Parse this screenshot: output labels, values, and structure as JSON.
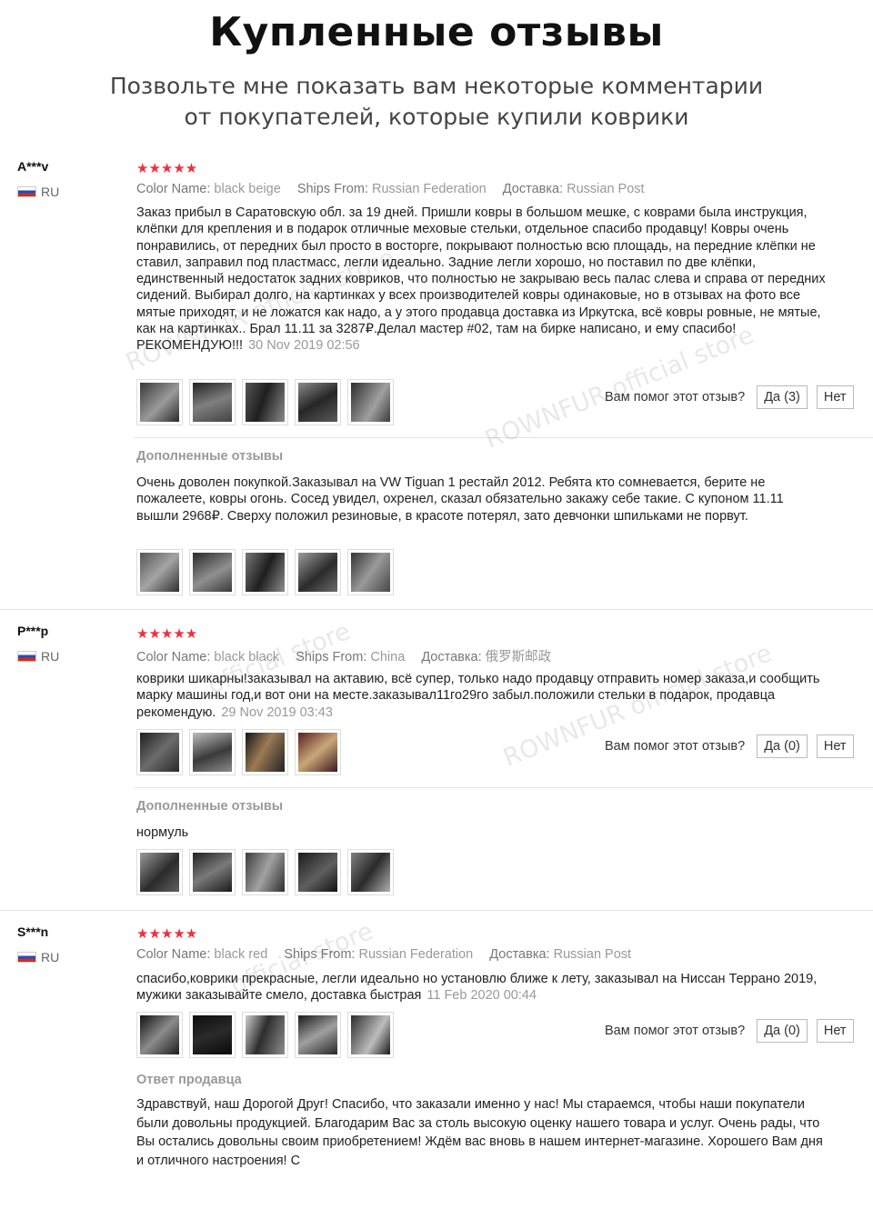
{
  "header": {
    "title": "Купленные отзывы",
    "subtitle_line1": "Позвольте мне показать вам некоторые комментарии",
    "subtitle_line2": "от покупателей, которые купили коврики"
  },
  "labels": {
    "color_name": "Color Name:",
    "ships_from": "Ships From:",
    "delivery": "Доставка:",
    "helpful_question": "Вам помог этот отзыв?",
    "no": "Нет",
    "additional_reviews": "Дополненные отзывы",
    "seller_reply": "Ответ продавца"
  },
  "watermarks": {
    "full": "ROWNFUR official store",
    "store": "official store"
  },
  "colors": {
    "star": "#ee2f3f",
    "text": "#222222",
    "meta": "#999999"
  },
  "reviews": [
    {
      "user": "A***v",
      "country": "RU",
      "rating": 5,
      "stars": "★★★★★",
      "color_name": "black beige",
      "ships_from": "Russian Federation",
      "delivery": "Russian Post",
      "text": "Заказ прибыл в Саратовскую обл. за 19 дней. Пришли ковры в большом мешке, с коврами была инструкция, клёпки для крепления и в подарок отличные меховые стельки, отдельное спасибо продавцу! Ковры очень понравились, от передних был просто в восторге, покрывают полностью всю площадь, на передние клёпки не ставил, заправил под пластмасс, легли идеально. Задние легли хорошо, но поставил по две клёпки, единственный недостаток задних ковриков, что полностью не закрываю весь палас слева и справа от передних сидений. Выбирал долго, на картинках у всех производителей ковры одинаковые, но в отзывах на фото все мятые приходят, и не ложатся как надо, а у этого продавца доставка из Иркутска, всё ковры ровные, не мятые, как на картинках.. Брал 11.11 за 3287₽.Делал мастер #02, там на бирке написано, и ему спасибо! РЕКОМЕНДУЮ!!!",
      "date": "30 Nov 2019 02:56",
      "yes": "Да (3)",
      "additional_text": "Очень доволен покупкой.Заказывал на VW Tiguan 1 рестайл 2012. Ребята кто сомневается, берите не пожалеете, ковры огонь. Сосед увидел, охренел, сказал обязательно закажу себе такие. С купоном 11.11 вышли 2968₽. Сверху положил резиновые, в красоте потерял, зато девчонки шпильками не порвут."
    },
    {
      "user": "P***p",
      "country": "RU",
      "rating": 5,
      "stars": "★★★★★",
      "color_name": "black black",
      "ships_from": "China",
      "delivery": "俄罗斯邮政",
      "text": "коврики шикарны!заказывал на актавию, всё супер, только надо продавцу отправить номер заказа,и сообщить марку машины год,и вот они на месте.заказывал11го29го забыл.положили стельки в подарок, продавца рекомендую.",
      "date": "29 Nov 2019 03:43",
      "yes": "Да (0)",
      "additional_text": "нормуль"
    },
    {
      "user": "S***n",
      "country": "RU",
      "rating": 5,
      "stars": "★★★★★",
      "color_name": "black red",
      "ships_from": "Russian Federation",
      "delivery": "Russian Post",
      "text": "спасибо,коврики прекрасные, легли идеально но установлю ближе к лету, заказывал на Ниссан Террано 2019, мужики заказывайте смело, доставка быстрая",
      "date": "11 Feb 2020 00:44",
      "yes": "Да (0)",
      "seller_reply": "Здравствуй, наш Дорогой Друг! Спасибо, что заказали именно у нас! Мы стараемся, чтобы наши покупатели были довольны продукцией. Благодарим Вас за столь высокую оценку нашего товара и услуг. Очень рады, что Вы остались довольны своим приобретением! Ждём вас вновь в нашем интернет-магазине. Хорошего Вам дня и отличного настроения! С"
    }
  ]
}
